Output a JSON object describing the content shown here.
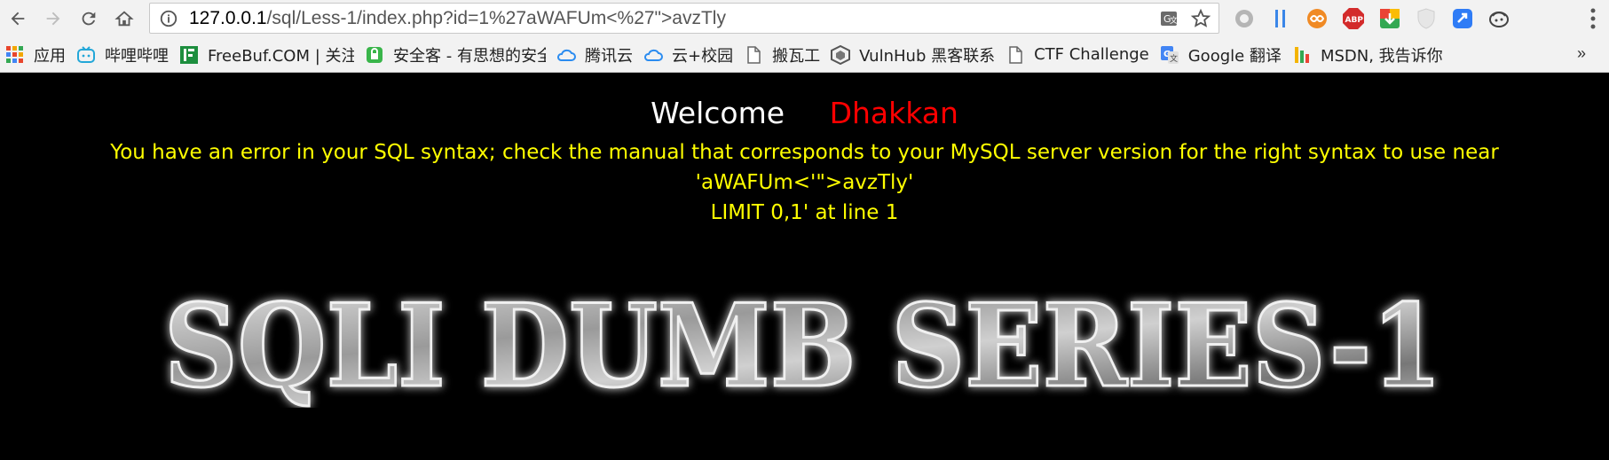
{
  "browser": {
    "url_host": "127.0.0.1",
    "url_rest": "/sql/Less-1/index.php?id=1%27aWAFUm<%27\">avzTly",
    "icons": {
      "back": "arrow-left-icon",
      "forward": "arrow-right-icon",
      "reload": "reload-icon",
      "home": "home-icon",
      "info": "info-icon",
      "translate": "translate-icon",
      "bookmark_star": "star-icon",
      "menu": "more-vert-icon"
    },
    "extensions": [
      "circle-extension-icon",
      "pause-extension-icon",
      "infinity-extension-icon",
      "adblock-plus-icon",
      "download-extension-icon",
      "shield-extension-icon",
      "blue-extension-icon",
      "cookie-extension-icon"
    ]
  },
  "bookmarks": [
    {
      "label": "应用",
      "icon": "apps-grid-icon"
    },
    {
      "label": "哔哩哔哩",
      "icon": "bilibili-icon"
    },
    {
      "label": "FreeBuf.COM | 关注",
      "icon": "freebuf-icon"
    },
    {
      "label": "安全客 - 有思想的安全",
      "icon": "anquanke-icon"
    },
    {
      "label": "腾讯云",
      "icon": "tencent-cloud-icon"
    },
    {
      "label": "云+校园",
      "icon": "cloud-campus-icon"
    },
    {
      "label": "搬瓦工",
      "icon": "page-icon"
    },
    {
      "label": "VulnHub 黑客联系",
      "icon": "vulnhub-icon"
    },
    {
      "label": "CTF Challenge",
      "icon": "page-icon"
    },
    {
      "label": "Google 翻译",
      "icon": "google-translate-icon"
    },
    {
      "label": "MSDN, 我告诉你",
      "icon": "msdn-icon"
    }
  ],
  "bookmarks_overflow": "»",
  "page": {
    "welcome": "Welcome",
    "username": "Dhakkan",
    "sql_error_line1": "You have an error in your SQL syntax; check the manual that corresponds to your MySQL server version for the right syntax to use near 'aWAFUm<'\">avzTly'",
    "sql_error_line2": "LIMIT 0,1' at line 1",
    "banner_text": "SQLI DUMB SERIES-1"
  },
  "colors": {
    "background": "#000000",
    "welcome": "#ffffff",
    "username": "#ff0000",
    "error": "#ffff00"
  }
}
